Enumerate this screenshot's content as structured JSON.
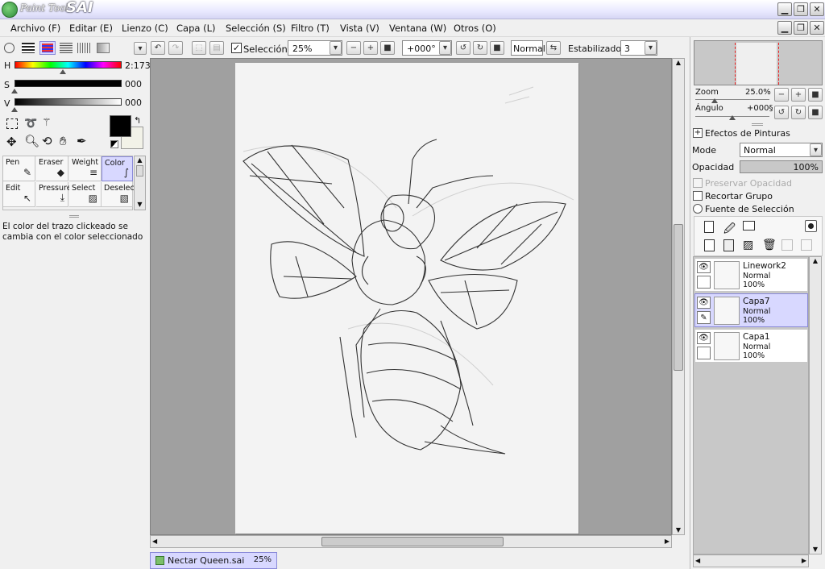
{
  "app": {
    "brand_small": "Paint Tool",
    "brand_big": "SAI"
  },
  "menu": [
    "Archivo (F)",
    "Editar (E)",
    "Lienzo (C)",
    "Capa (L)",
    "Selección (S)",
    "Filtro (T)",
    "Vista (V)",
    "Ventana (W)",
    "Otros (O)"
  ],
  "color": {
    "h_label": "H",
    "h_value": "2:173",
    "s_label": "S",
    "s_value": "000",
    "v_label": "V",
    "v_value": "000",
    "foreground": "#000000",
    "background": "#f2f2e8"
  },
  "tools": [
    {
      "name": "Pen",
      "icon": "pen-icon"
    },
    {
      "name": "Eraser",
      "icon": "eraser-icon"
    },
    {
      "name": "Weight",
      "icon": "weight-icon"
    },
    {
      "name": "Color",
      "icon": "color-icon",
      "selected": true
    },
    {
      "name": "Edit",
      "icon": "edit-icon"
    },
    {
      "name": "Pressure",
      "icon": "pressure-icon"
    },
    {
      "name": "Select",
      "icon": "select-icon"
    },
    {
      "name": "Deselect",
      "icon": "deselect-icon"
    }
  ],
  "hint": "El color del trazo clickeado se cambia con el color seleccionado",
  "toolbar": {
    "seleccion_label": "Selección",
    "zoom": "25%",
    "angle": "+000°",
    "blend": "Normal",
    "stabilizer_label": "Estabilizador",
    "stabilizer_value": "3"
  },
  "navigator": {
    "zoom_label": "Zoom",
    "zoom_value": "25.0%",
    "angle_label": "Ángulo",
    "angle_value": "+000§"
  },
  "layers_panel": {
    "effects_label": "Efectos de Pinturas",
    "mode_label": "Mode",
    "mode_value": "Normal",
    "opacity_label": "Opacidad",
    "opacity_value": "100%",
    "preserve_label": "Preservar Opacidad",
    "clip_label": "Recortar Grupo",
    "source_label": "Fuente de Selección"
  },
  "layers": [
    {
      "name": "Linework2",
      "mode": "Normal",
      "opacity": "100%",
      "selected": false
    },
    {
      "name": "Capa7",
      "mode": "Normal",
      "opacity": "100%",
      "selected": true
    },
    {
      "name": "Capa1",
      "mode": "Normal",
      "opacity": "100%",
      "selected": false
    }
  ],
  "document": {
    "name": "Nectar Queen.sai",
    "zoom": "25%"
  }
}
